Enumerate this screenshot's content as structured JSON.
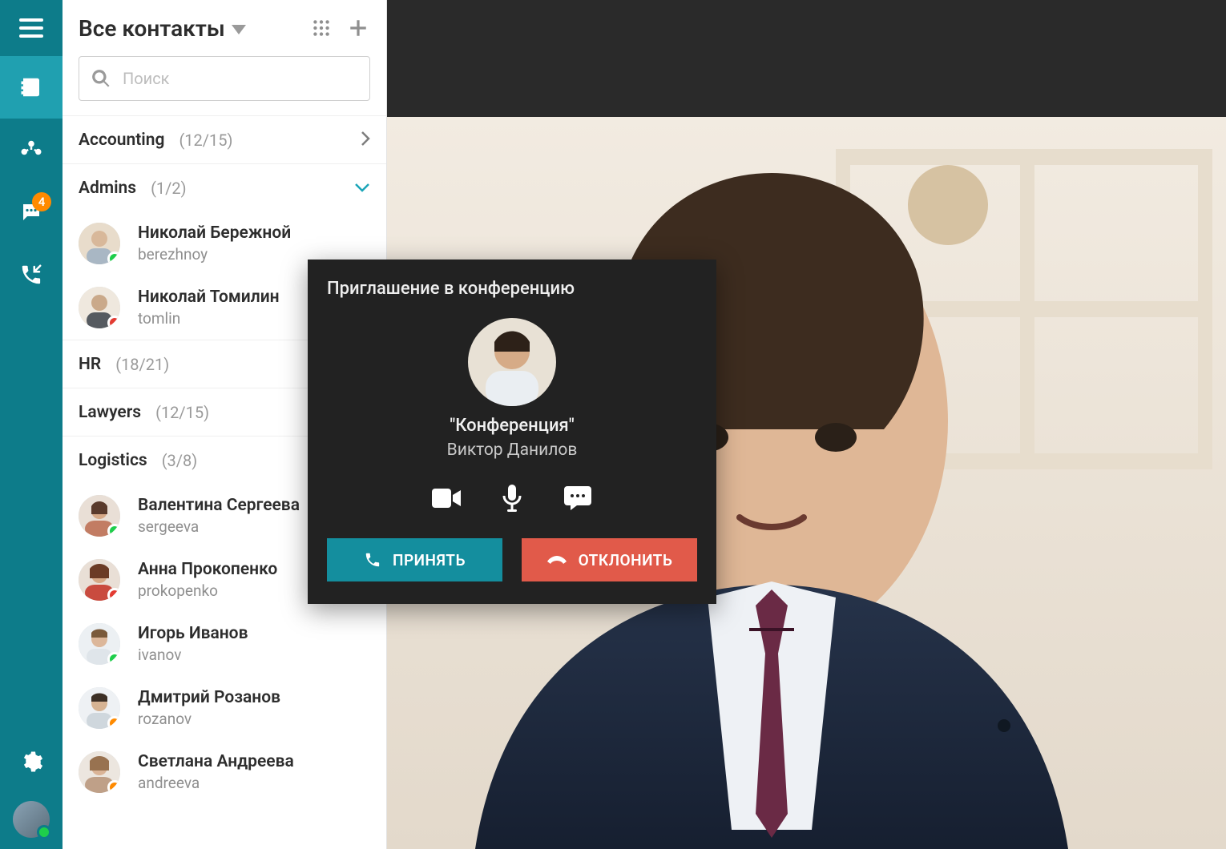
{
  "rail": {
    "chat_badge": "4"
  },
  "contacts": {
    "title": "Все контакты",
    "search_placeholder": "Поиск",
    "groups": {
      "accounting": {
        "name": "Accounting",
        "count": "(12/15)"
      },
      "admins": {
        "name": "Admins",
        "count": "(1/2)"
      },
      "hr": {
        "name": "HR",
        "count": "(18/21)"
      },
      "lawyers": {
        "name": "Lawyers",
        "count": "(12/15)"
      },
      "logistics": {
        "name": "Logistics",
        "count": "(3/8)"
      }
    },
    "admins_members": [
      {
        "name": "Николай Бережной",
        "login": "berezhnoy",
        "status": "online"
      },
      {
        "name": "Николай Томилин",
        "login": "tomlin",
        "status": "busy"
      }
    ],
    "logistics_members": [
      {
        "name": "Валентина Сергеева",
        "login": "sergeeva",
        "status": "online"
      },
      {
        "name": "Анна Прокопенко",
        "login": "prokopenko",
        "status": "busy"
      },
      {
        "name": "Игорь Иванов",
        "login": "ivanov",
        "status": "online"
      },
      {
        "name": "Дмитрий Розанов",
        "login": "rozanov",
        "status": "away"
      },
      {
        "name": "Светлана Андреева",
        "login": "andreeva",
        "status": "away"
      }
    ]
  },
  "invite": {
    "title": "Приглашение в конференцию",
    "conference": "\"Конференция\"",
    "caller": "Виктор Данилов",
    "accept": "ПРИНЯТЬ",
    "decline": "ОТКЛОНИТЬ"
  }
}
